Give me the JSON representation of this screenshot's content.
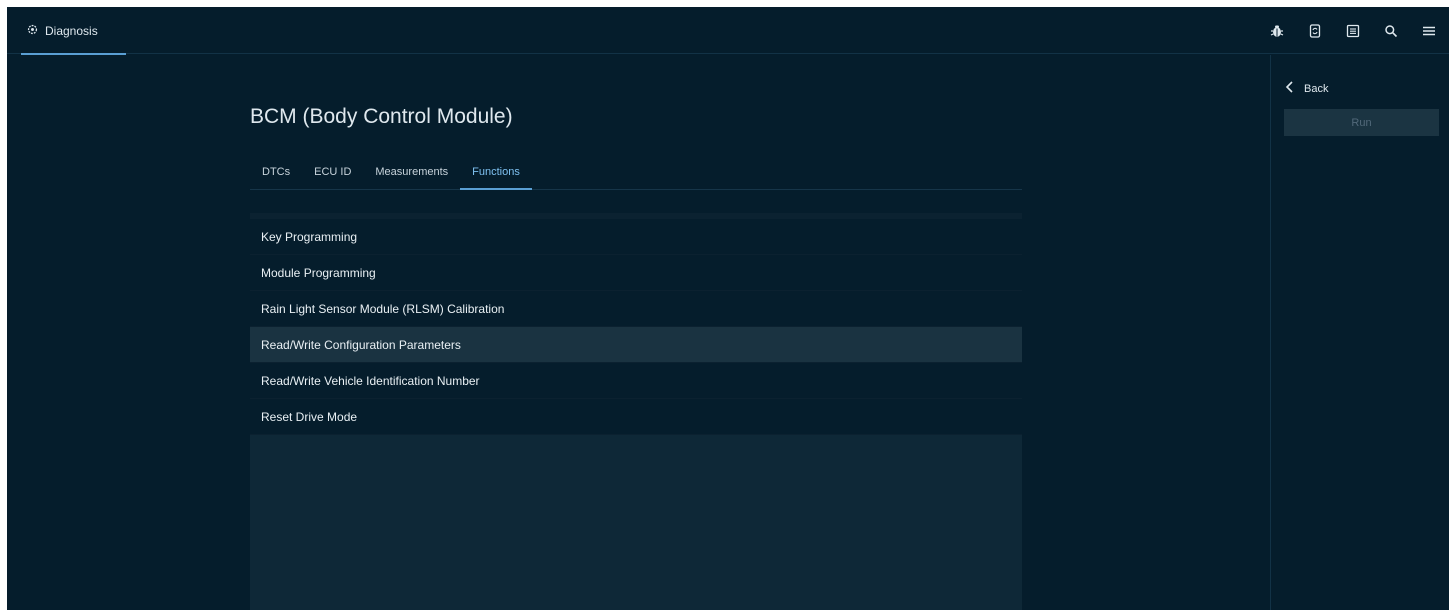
{
  "app": {
    "tab_label": "Diagnosis",
    "tab_icon": "gear-icon"
  },
  "toolbar": {
    "icons": [
      "bug-icon",
      "vehicle-sync-icon",
      "list-icon",
      "search-icon",
      "menu-icon"
    ]
  },
  "page": {
    "title": "BCM (Body Control Module)",
    "tabs": [
      {
        "label": "DTCs",
        "active": false
      },
      {
        "label": "ECU ID",
        "active": false
      },
      {
        "label": "Measurements",
        "active": false
      },
      {
        "label": "Functions",
        "active": true
      }
    ],
    "functions": [
      {
        "label": "Key Programming",
        "highlighted": false
      },
      {
        "label": "Module Programming",
        "highlighted": false
      },
      {
        "label": "Rain Light Sensor Module (RLSM) Calibration",
        "highlighted": false
      },
      {
        "label": "Read/Write Configuration Parameters",
        "highlighted": true
      },
      {
        "label": "Read/Write Vehicle Identification Number",
        "highlighted": false
      },
      {
        "label": "Reset Drive Mode",
        "highlighted": false
      }
    ]
  },
  "side": {
    "back_label": "Back",
    "run_label": "Run",
    "run_disabled": true
  },
  "colors": {
    "background": "#051d2c",
    "accent": "#5a9fd4",
    "highlight_row": "#1a3341"
  }
}
